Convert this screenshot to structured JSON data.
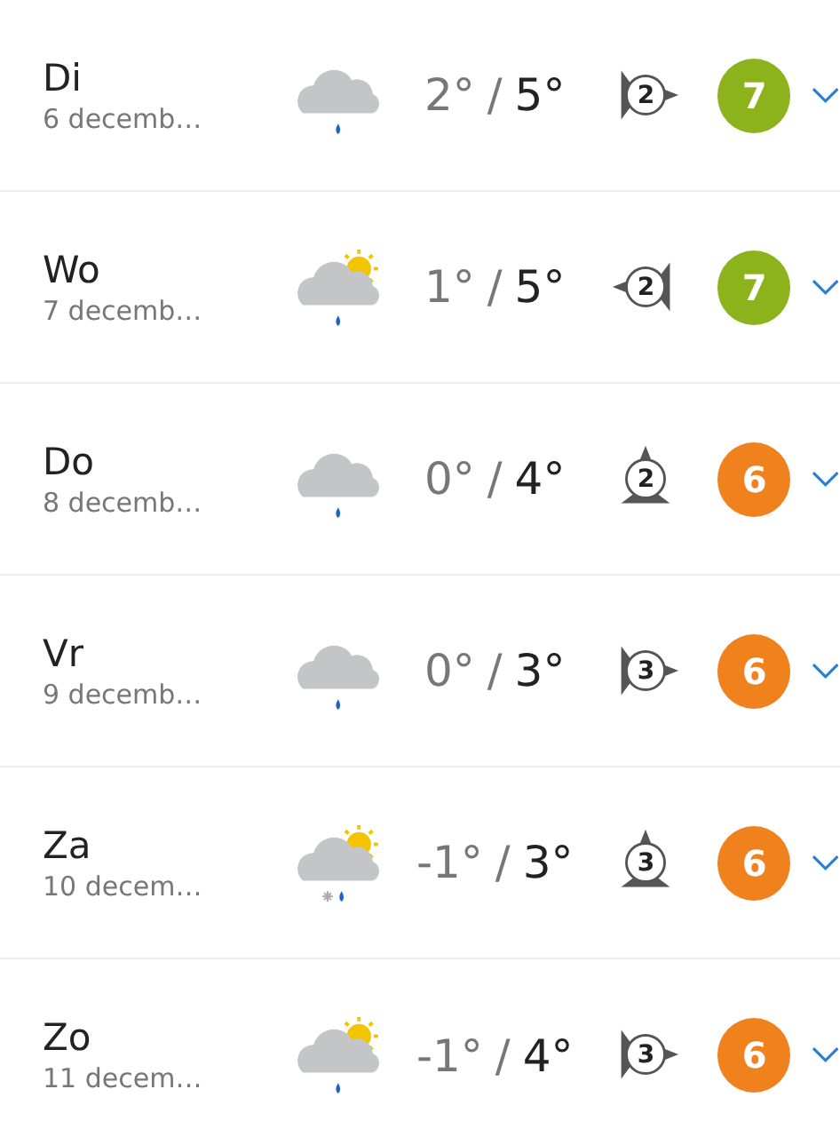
{
  "days": [
    {
      "day": "Di",
      "date": "6 decemb…",
      "weather": {
        "kind": "rain"
      },
      "low": "2°",
      "separator": "/",
      "high": "5°",
      "wind": {
        "speed": "2",
        "kind": "east"
      },
      "rating": "7",
      "color": "#8db31c"
    },
    {
      "day": "Wo",
      "date": "7 decemb…",
      "weather": {
        "kind": "sunrain"
      },
      "low": "1°",
      "separator": "/",
      "high": "5°",
      "wind": {
        "speed": "2",
        "kind": "west"
      },
      "rating": "7",
      "color": "#8db31c"
    },
    {
      "day": "Do",
      "date": "8 decemb…",
      "weather": {
        "kind": "rain"
      },
      "low": "0°",
      "separator": "/",
      "high": "4°",
      "wind": {
        "speed": "2",
        "kind": "north"
      },
      "rating": "6",
      "color": "#f0821e"
    },
    {
      "day": "Vr",
      "date": "9 decemb…",
      "weather": {
        "kind": "rain"
      },
      "low": "0°",
      "separator": "/",
      "high": "3°",
      "wind": {
        "speed": "3",
        "kind": "east"
      },
      "rating": "6",
      "color": "#f0821e"
    },
    {
      "day": "Za",
      "date": "10 decem…",
      "weather": {
        "kind": "sunsleet"
      },
      "low": "-1°",
      "separator": "/",
      "high": "3°",
      "wind": {
        "speed": "3",
        "kind": "north"
      },
      "rating": "6",
      "color": "#f0821e"
    },
    {
      "day": "Zo",
      "date": "11 decem…",
      "weather": {
        "kind": "sunrain"
      },
      "low": "-1°",
      "separator": "/",
      "high": "4°",
      "wind": {
        "speed": "3",
        "kind": "east"
      },
      "rating": "6",
      "color": "#f0821e"
    }
  ]
}
